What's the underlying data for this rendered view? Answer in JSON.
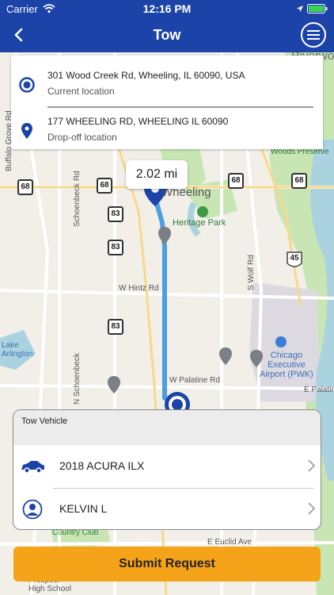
{
  "status_bar": {
    "carrier": "Carrier",
    "time": "12:16 PM"
  },
  "nav": {
    "title": "Tow"
  },
  "locations": {
    "current_address": "301 Wood Creek Rd, Wheeling, IL 60090, USA",
    "current_label": "Current location",
    "dropoff_address": "177 WHEELING RD, WHEELING IL 60090",
    "dropoff_label": "Drop-off location"
  },
  "distance": "2.02 mi",
  "map_labels": {
    "riverwoods": "Riverwoods",
    "wheeling": "Wheeling",
    "heritage_park": "Heritage Park",
    "woods_preserve": "Woods Preserve",
    "w_hintz": "W Hintz Rd",
    "s_wolf": "S Wolf Rd",
    "chicago_airport": "Chicago\nExecutive\nAirport (PWK)",
    "w_palatine_1": "W Palatine Rd",
    "w_palatine_2": "E Palatine",
    "schoenbeck": "Schoenbeck Rd",
    "n_schoenbeck": "N Schoenbeck",
    "ruffalo_grove": "Buffalo Grove Rd",
    "lake_arlington": "Lake\nArlington",
    "country_club": "Country Club",
    "e_euclid": "E Euclid Ave",
    "prospect": "Prospect\nHigh School",
    "route_68": "68",
    "route_83": "83",
    "route_45": "45"
  },
  "panel": {
    "header": "Tow Vehicle",
    "vehicle": "2018 ACURA ILX",
    "driver": "KELVIN L"
  },
  "submit_label": "Submit Request",
  "colors": {
    "brand_blue": "#1c44a8",
    "route_blue": "#4a9fe0",
    "accent_orange": "#f5a318"
  }
}
